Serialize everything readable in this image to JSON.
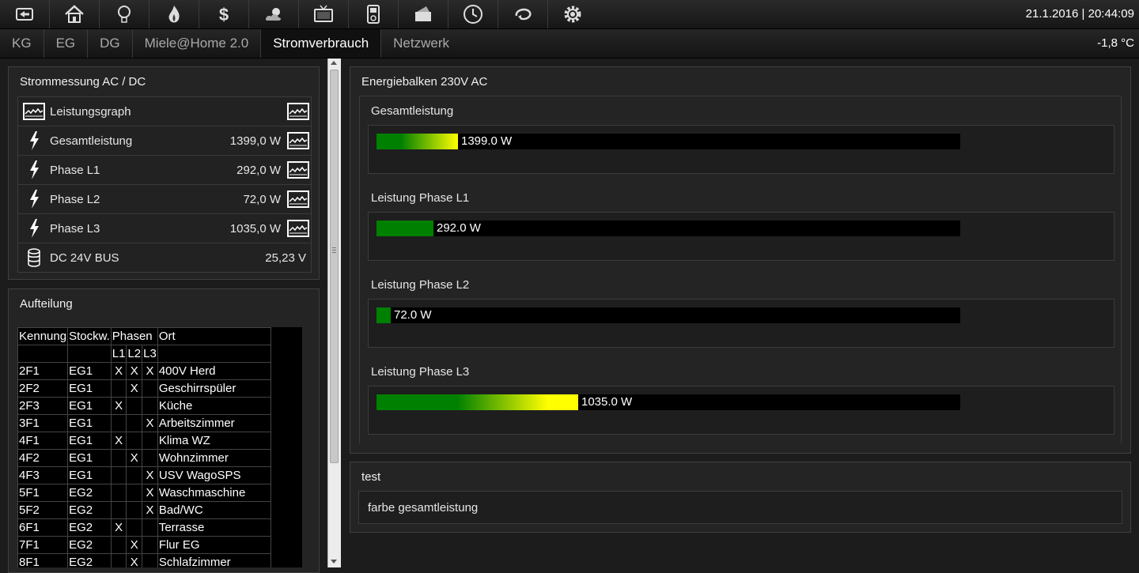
{
  "topnav": {
    "icons": [
      "back-icon",
      "home-icon",
      "bulb-icon",
      "flame-icon",
      "dollar-icon",
      "weather-icon",
      "tv-icon",
      "media-player-icon",
      "mail-icon",
      "clock-icon",
      "refresh-icon",
      "gear-icon"
    ],
    "datetime": "21.1.2016 | 20:44:09"
  },
  "tabs": [
    "KG",
    "EG",
    "DG",
    "Miele@Home 2.0",
    "Stromverbrauch",
    "Netzwerk"
  ],
  "active_tab": "Stromverbrauch",
  "temperature": "-1,8 °C",
  "strommessung": {
    "title": "Strommessung AC / DC",
    "rows": [
      {
        "label": "Leistungsgraph",
        "value": ""
      },
      {
        "label": "Gesamtleistung",
        "value": "1399,0 W"
      },
      {
        "label": "Phase L1",
        "value": "292,0 W"
      },
      {
        "label": "Phase L2",
        "value": "72,0 W"
      },
      {
        "label": "Phase L3",
        "value": "1035,0 W"
      },
      {
        "label": "DC 24V BUS",
        "value": "25,23 V"
      }
    ]
  },
  "aufteilung": {
    "title": "Aufteilung",
    "headers": [
      "Kennung",
      "Stockw.",
      "Phasen",
      "Ort"
    ],
    "subheaders": [
      "L1",
      "L2",
      "L3"
    ],
    "rows": [
      [
        "2F1",
        "EG1",
        "X",
        "X",
        "X",
        "400V Herd"
      ],
      [
        "2F2",
        "EG1",
        "",
        "X",
        "",
        "Geschirrspüler"
      ],
      [
        "2F3",
        "EG1",
        "X",
        "",
        "",
        "Küche"
      ],
      [
        "3F1",
        "EG1",
        "",
        "",
        "X",
        "Arbeitszimmer"
      ],
      [
        "4F1",
        "EG1",
        "X",
        "",
        "",
        "Klima WZ"
      ],
      [
        "4F2",
        "EG1",
        "",
        "X",
        "",
        "Wohnzimmer"
      ],
      [
        "4F3",
        "EG1",
        "",
        "",
        "X",
        "USV WagoSPS"
      ],
      [
        "5F1",
        "EG2",
        "",
        "",
        "X",
        "Waschmaschine"
      ],
      [
        "5F2",
        "EG2",
        "",
        "",
        "X",
        "Bad/WC"
      ],
      [
        "6F1",
        "EG2",
        "X",
        "",
        "",
        "Terrasse"
      ],
      [
        "7F1",
        "EG2",
        "",
        "X",
        "",
        "Flur EG"
      ],
      [
        "8F1",
        "EG2",
        "",
        "X",
        "",
        "Schlafzimmer"
      ]
    ]
  },
  "energiebalken": {
    "title": "Energiebalken 230V AC",
    "bars": [
      {
        "title": "Gesamtleistung",
        "label": "1399.0 W",
        "fill_fraction": 0.139,
        "gradient": "linear-gradient(to right,#008000 0%,#008000 30%,#ffff00 100%)"
      },
      {
        "title": "Leistung Phase L1",
        "label": "292.0 W",
        "fill_fraction": 0.097,
        "gradient": "#008000"
      },
      {
        "title": "Leistung Phase L2",
        "label": "72.0 W",
        "fill_fraction": 0.024,
        "gradient": "#008000"
      },
      {
        "title": "Leistung Phase L3",
        "label": "1035.0 W",
        "fill_fraction": 0.345,
        "gradient": "linear-gradient(to right,#008000 0%,#008000 40%,#ffff00 85%,#ffff00 100%)"
      }
    ]
  },
  "test_panel": {
    "title": "test",
    "text": "farbe gesamtleistung"
  }
}
